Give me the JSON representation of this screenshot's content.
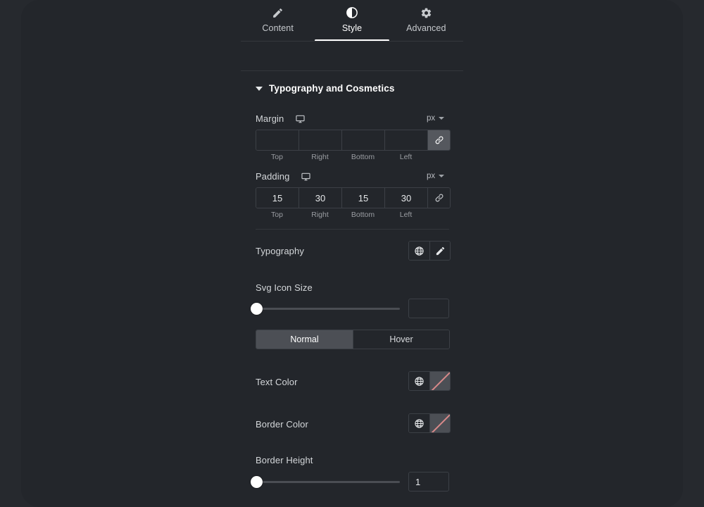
{
  "theme": {
    "page_bg": "#26292e",
    "panel_bg": "#23262b",
    "border": "#3c4046",
    "text": "#d4d7da",
    "text_strong": "#ffffff",
    "muted": "#9a9da2",
    "active_fill": "#4c4f55",
    "swatch_slash": "#d98a8a"
  },
  "tabs": [
    {
      "label": "Content",
      "icon": "pencil-icon",
      "active": false
    },
    {
      "label": "Style",
      "icon": "contrast-icon",
      "active": true
    },
    {
      "label": "Advanced",
      "icon": "gear-icon",
      "active": false
    }
  ],
  "section": {
    "title": "Typography and Cosmetics",
    "caret": "caret-down-icon",
    "expanded": true
  },
  "margin": {
    "label": "Margin",
    "device_icon": "desktop-icon",
    "unit": "px",
    "unit_caret": "chevron-down-icon",
    "values": [
      "",
      "",
      "",
      ""
    ],
    "captions": [
      "Top",
      "Right",
      "Bottom",
      "Left"
    ],
    "link_icon": "link-icon",
    "linked": true
  },
  "padding": {
    "label": "Padding",
    "device_icon": "desktop-icon",
    "unit": "px",
    "unit_caret": "chevron-down-icon",
    "values": [
      "15",
      "30",
      "15",
      "30"
    ],
    "captions": [
      "Top",
      "Right",
      "Bottom",
      "Left"
    ],
    "link_icon": "link-icon",
    "linked": false
  },
  "typography": {
    "label": "Typography",
    "globe_icon": "globe-icon",
    "edit_icon": "pencil-icon"
  },
  "svg_icon_size": {
    "label": "Svg Icon Size",
    "value": "",
    "slider_percent": 0
  },
  "state_toggle": {
    "options": [
      "Normal",
      "Hover"
    ],
    "selected": "Normal"
  },
  "text_color": {
    "label": "Text Color",
    "globe_icon": "globe-icon",
    "swatch": "none"
  },
  "border_color": {
    "label": "Border Color",
    "globe_icon": "globe-icon",
    "swatch": "none"
  },
  "border_height": {
    "label": "Border Height",
    "value": "1",
    "slider_percent": 0
  }
}
